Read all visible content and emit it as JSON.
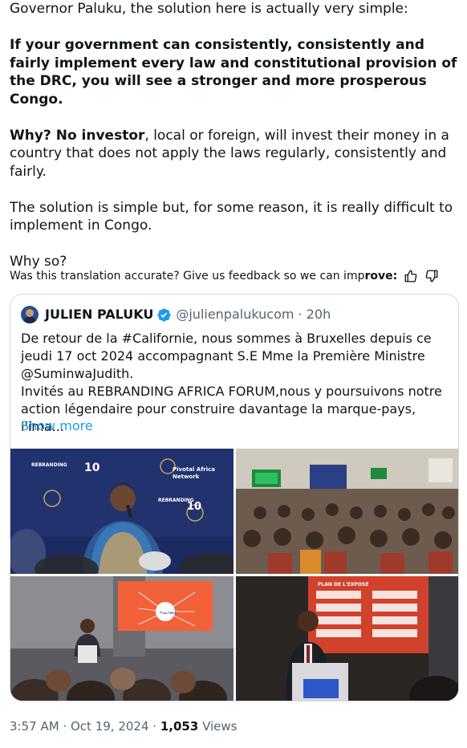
{
  "tweet": {
    "line1": "Governor Paluku, the solution here is actually very simple:",
    "bold_para": "If your government can consistently, consistently and fairly implement every law and constitutional provision of the DRC, you will see a stronger and more prosperous Congo.",
    "why_bold": "Why? No investor",
    "why_rest": ", local or foreign, will invest their money in a country that does not apply the laws regularly, consistently and fairly.",
    "solution": "The solution is simple but, for some reason, it is really difficult to implement in Congo.",
    "why_so": "Why so?"
  },
  "feedback": {
    "text_prefix": "Was this translation accurate? Give us feedback so we can imp",
    "text_bold": "rove:",
    "thumbs_up_icon": "thumbs-up-icon",
    "thumbs_down_icon": "thumbs-down-icon"
  },
  "quote": {
    "name": "JULIEN PALUKU",
    "handle": "@julienpalukucom",
    "separator": "·",
    "time": "20h",
    "text_line1": "De retour de la #Californie, nous sommes à Bruxelles depuis ce jeudi 17 oct 2024 accompagnant S.E Mme la Première Ministre @SuminwaJudith.",
    "text_line2": "Invités au REBRANDING AFRICA FORUM,nous y  poursuivons notre action légendaire pour construire davantage la marque-pays, l'ima...",
    "show_more": "Show more",
    "photo_texts": {
      "banner1": "REBRANDING AFRICA FORUM",
      "banner2": "Pivotal Africa Network",
      "slide1": "Sectors",
      "slide2": "PLAN DE L'EXPOSE"
    }
  },
  "meta": {
    "time": "3:57 AM",
    "dot": "·",
    "date": "Oct 19, 2024",
    "dot2": "·",
    "views_count": "1,053",
    "views_label": "Views"
  },
  "colors": {
    "link": "#1d9bf0",
    "muted": "#536471",
    "verified": "#1d9bf0",
    "border": "#cfd9de"
  }
}
